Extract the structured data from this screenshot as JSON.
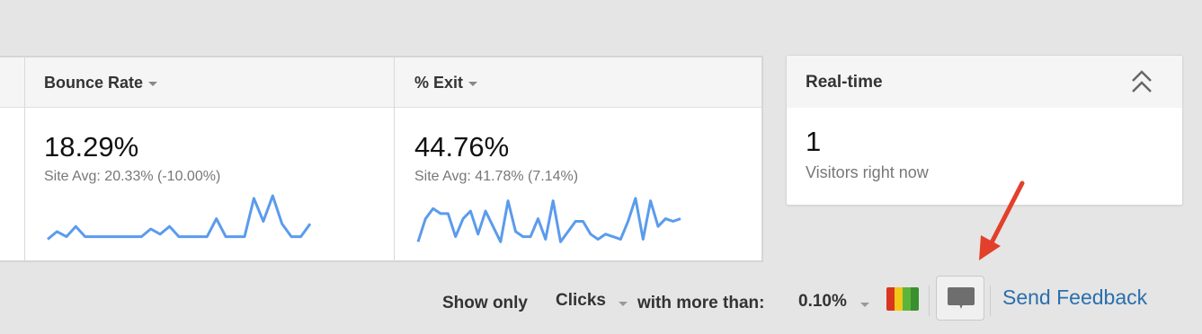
{
  "metrics": [
    {
      "title": "Bounce Rate",
      "value": "18.29%",
      "site_avg": "Site Avg: 20.33% (-10.00%)",
      "sparkline": [
        0.15,
        0.3,
        0.2,
        0.4,
        0.2,
        0.2,
        0.2,
        0.2,
        0.2,
        0.2,
        0.2,
        0.35,
        0.25,
        0.4,
        0.2,
        0.2,
        0.2,
        0.2,
        0.55,
        0.2,
        0.2,
        0.2,
        0.95,
        0.5,
        1.0,
        0.45,
        0.2,
        0.2,
        0.45
      ],
      "sparkline_color": "#5b9bec"
    },
    {
      "title": "% Exit",
      "value": "44.76%",
      "site_avg": "Site Avg: 41.78% (7.14%)",
      "sparkline": [
        0.1,
        0.55,
        0.75,
        0.65,
        0.65,
        0.2,
        0.55,
        0.7,
        0.25,
        0.7,
        0.4,
        0.1,
        0.9,
        0.3,
        0.2,
        0.2,
        0.55,
        0.15,
        0.9,
        0.1,
        0.3,
        0.5,
        0.5,
        0.25,
        0.15,
        0.25,
        0.2,
        0.15,
        0.5,
        0.95,
        0.15,
        0.9,
        0.4,
        0.55,
        0.5,
        0.55
      ],
      "sparkline_color": "#5b9bec"
    }
  ],
  "realtime": {
    "title": "Real-time",
    "value": "1",
    "label": "Visitors right now"
  },
  "footer": {
    "show_only": "Show only",
    "metric": "Clicks",
    "with_more_than": "with more than:",
    "threshold": "0.10%",
    "send_feedback": "Send Feedback",
    "heatmap_colors": [
      "#d9361f",
      "#f2c718",
      "#5cb53a",
      "#3a8f2e"
    ],
    "arrow_color": "#e2402a",
    "link_color": "#2a6fad"
  }
}
